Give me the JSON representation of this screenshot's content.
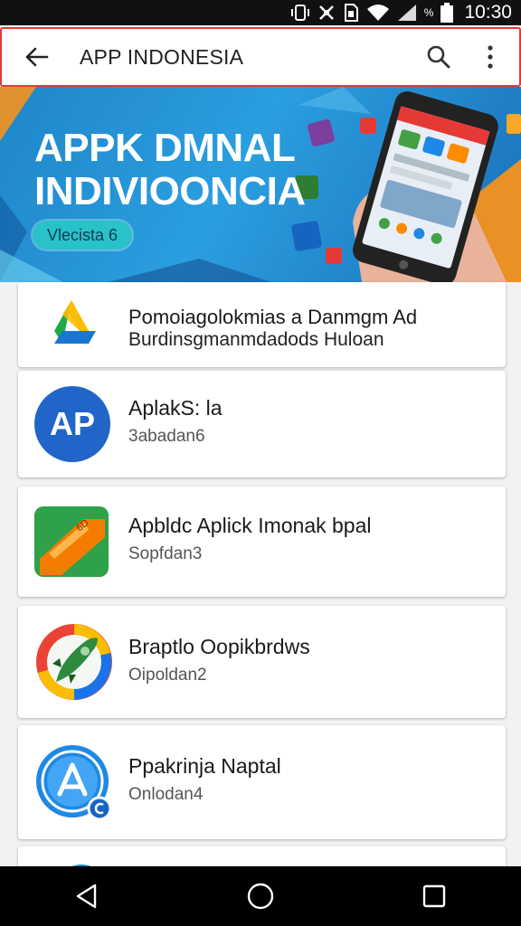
{
  "status_bar": {
    "time": "10:30",
    "battery_text": "%",
    "icons": [
      "vibrate-icon",
      "no-signal-icon",
      "sim-icon",
      "wifi-icon",
      "signal-icon",
      "battery-icon"
    ]
  },
  "app_bar": {
    "title": "APP INDONESIA",
    "back_icon": "arrow-left-icon",
    "search_icon": "search-icon",
    "menu_icon": "more-vert-icon"
  },
  "banner": {
    "headline_line1": "APPK DMNAL",
    "headline_line2": "INDIVIOONCIA",
    "pill_label": "Vlecista 6",
    "colors": {
      "background": "#2a9ee0",
      "pill": "#29c2c8",
      "accent": "#f5921e"
    }
  },
  "apps": [
    {
      "title": "Pomoiagolokmias a Danmgm Ad",
      "subtitle": "Burdinsgmanmdadods Huloan",
      "icon": "drive-triangle-icon"
    },
    {
      "title": "AplakS: la",
      "subtitle": "3abadan6",
      "icon": "ap-circle-icon",
      "icon_text": "AP"
    },
    {
      "title": "Apbldc Aplick Imonak bpal",
      "subtitle": "Sopfdan3",
      "icon": "green-orange-tile-icon"
    },
    {
      "title": "Braptlo Oopikbrdws",
      "subtitle": "Oipoldan2",
      "icon": "rocket-icon"
    },
    {
      "title": "Ppakrinja Naptal",
      "subtitle": "Onlodan4",
      "icon": "app-store-icon"
    }
  ],
  "nav_bar": {
    "back": "nav-back-icon",
    "home": "nav-home-icon",
    "recents": "nav-recents-icon"
  }
}
